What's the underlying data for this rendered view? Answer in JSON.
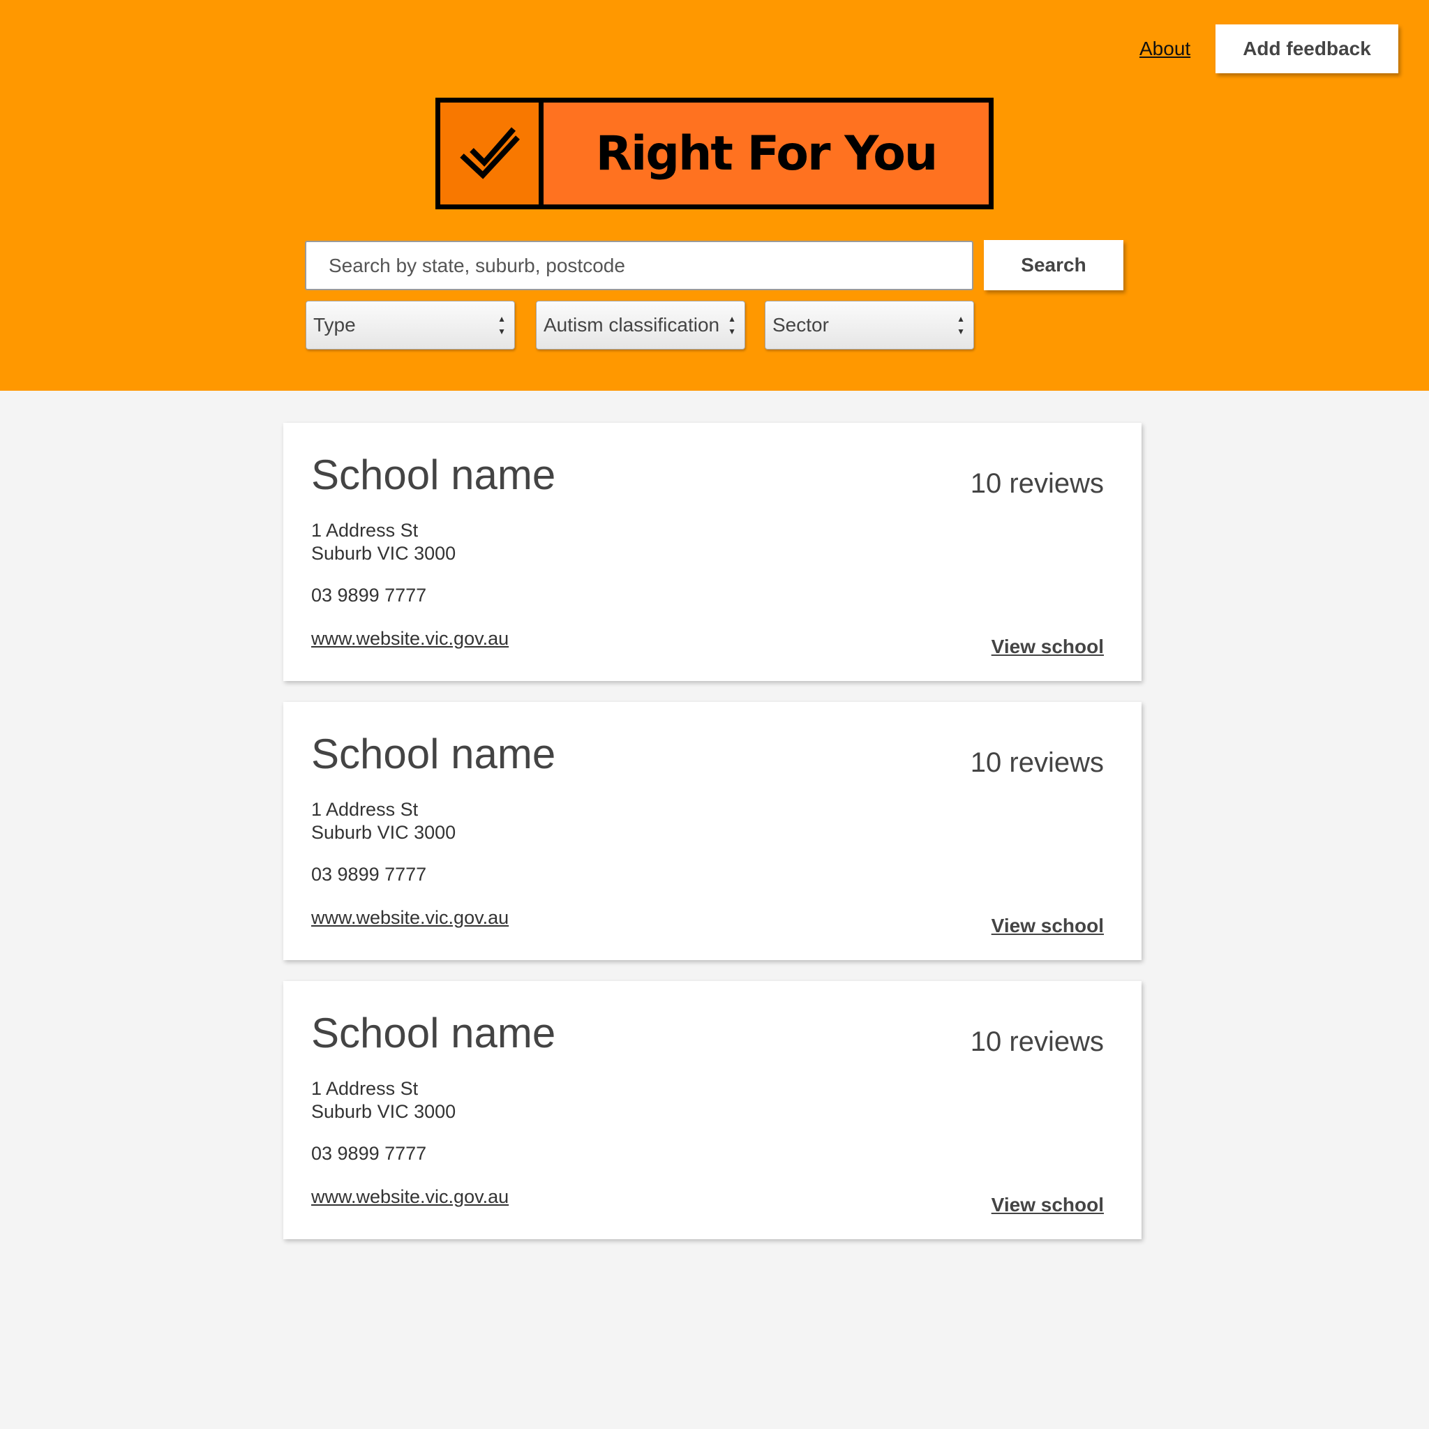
{
  "header": {
    "about_label": "About",
    "feedback_label": "Add feedback",
    "background_color": "#ff9800"
  },
  "logo": {
    "text": "Right For You",
    "icon": "double-check-icon",
    "mark_color": "#f87800",
    "text_bg_color": "#ff7220"
  },
  "search": {
    "placeholder": "Search by state, suburb, postcode",
    "value": "",
    "button_label": "Search"
  },
  "filters": [
    {
      "label": "Type"
    },
    {
      "label": "Autism classification"
    },
    {
      "label": "Sector"
    }
  ],
  "results": [
    {
      "name": "School name",
      "reviews": "10 reviews",
      "address_line1": "1 Address St",
      "address_line2": "Suburb VIC 3000",
      "phone": "03 9899 7777",
      "website": "www.website.vic.gov.au",
      "view_label": "View school"
    },
    {
      "name": "School name",
      "reviews": "10 reviews",
      "address_line1": "1 Address St",
      "address_line2": "Suburb VIC 3000",
      "phone": "03 9899 7777",
      "website": "www.website.vic.gov.au",
      "view_label": "View school"
    },
    {
      "name": "School name",
      "reviews": "10 reviews",
      "address_line1": "1 Address St",
      "address_line2": "Suburb VIC 3000",
      "phone": "03 9899 7777",
      "website": "www.website.vic.gov.au",
      "view_label": "View school"
    }
  ]
}
